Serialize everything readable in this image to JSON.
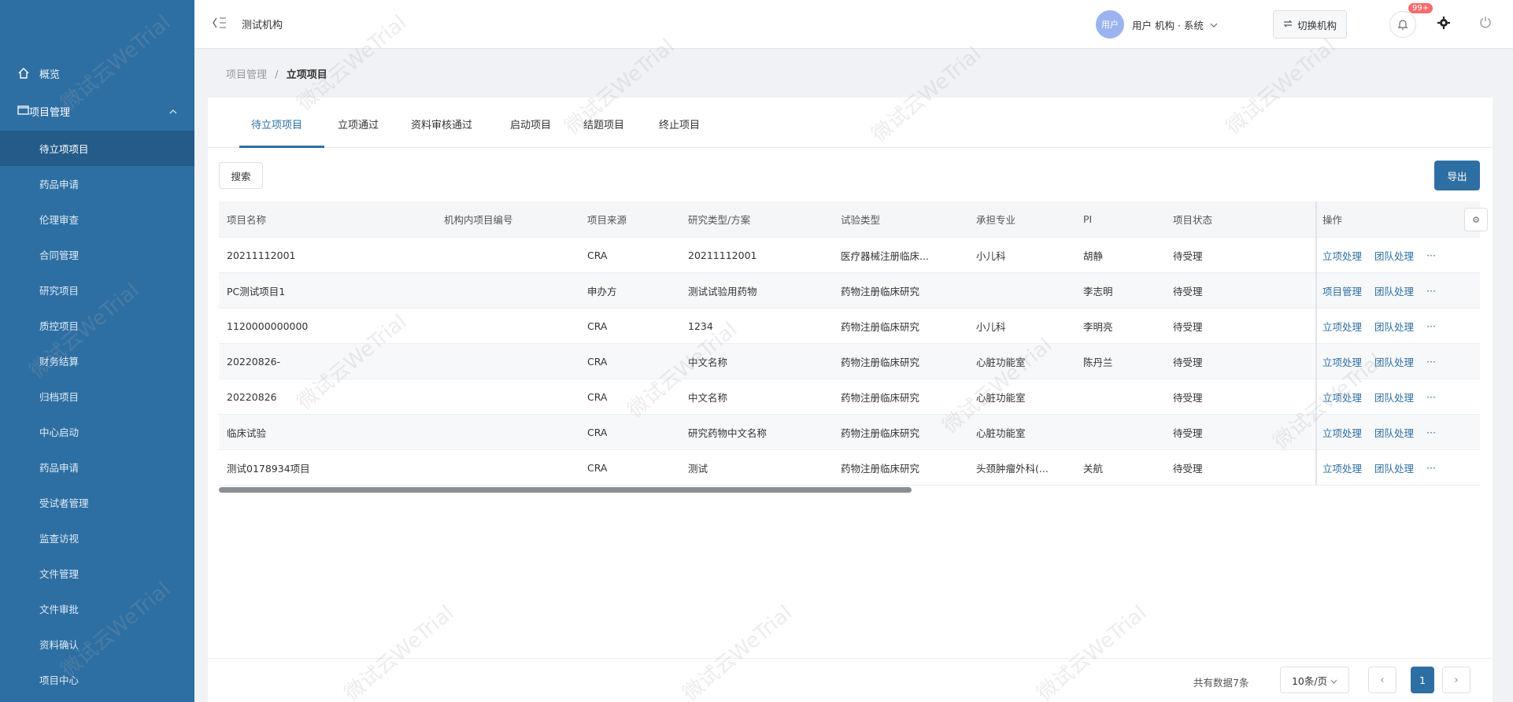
{
  "header": {
    "org_name": "测试机构",
    "avatar_text": "用户",
    "user_text": "用户 机构 · 系统",
    "switch_label": "切换机构",
    "notification_badge": "99+"
  },
  "sidebar": {
    "home_label": "概览",
    "group_label": "项目管理",
    "items": [
      {
        "label": "待立项项目"
      },
      {
        "label": "药品申请"
      },
      {
        "label": "伦理审查"
      },
      {
        "label": "合同管理"
      },
      {
        "label": "研究项目"
      },
      {
        "label": "质控项目"
      },
      {
        "label": "财务结算"
      },
      {
        "label": "归档项目"
      },
      {
        "label": "中心启动"
      },
      {
        "label": "药品申请"
      },
      {
        "label": "受试者管理"
      },
      {
        "label": "监查访视"
      },
      {
        "label": "文件管理"
      },
      {
        "label": "文件审批"
      },
      {
        "label": "资料确认"
      },
      {
        "label": "项目中心"
      }
    ]
  },
  "breadcrumb": {
    "parent": "项目管理",
    "sep": "/",
    "current": "立项项目"
  },
  "tabs": [
    {
      "label": "待立项项目"
    },
    {
      "label": "立项通过"
    },
    {
      "label": "资料审核通过"
    },
    {
      "label": "启动项目"
    },
    {
      "label": "结题项目"
    },
    {
      "label": "终止项目"
    }
  ],
  "toolbar": {
    "search_label": "搜索",
    "export_label": "导出"
  },
  "table": {
    "headers": [
      "项目名称",
      "机构内项目编号",
      "项目来源",
      "研究类型/方案",
      "试验类型",
      "承担专业",
      "PI",
      "项目状态",
      "操作"
    ],
    "column_setting": "⚙",
    "rows": [
      {
        "name": "20211112001",
        "code": "",
        "source": "CRA",
        "plan": "20211112001",
        "type": "医疗器械注册临床...",
        "dept": "小儿科",
        "pi": "胡静",
        "status": "待受理",
        "op1": "立项处理",
        "op2": "团队处理",
        "more": "···"
      },
      {
        "name": "PC测试项目1",
        "code": "",
        "source": "申办方",
        "plan": "测试试验用药物",
        "type": "药物注册临床研究",
        "dept": "",
        "pi": "李志明",
        "status": "待受理",
        "op1": "项目管理",
        "op2": "团队处理",
        "more": "···"
      },
      {
        "name": "1120000000000",
        "code": "",
        "source": "CRA",
        "plan": "1234",
        "type": "药物注册临床研究",
        "dept": "小儿科",
        "pi": "李明亮",
        "status": "待受理",
        "op1": "立项处理",
        "op2": "团队处理",
        "more": "···"
      },
      {
        "name": "20220826-",
        "code": "",
        "source": "CRA",
        "plan": "中文名称",
        "type": "药物注册临床研究",
        "dept": "心脏功能室",
        "pi": "陈丹兰",
        "status": "待受理",
        "op1": "立项处理",
        "op2": "团队处理",
        "more": "···"
      },
      {
        "name": "20220826",
        "code": "",
        "source": "CRA",
        "plan": "中文名称",
        "type": "药物注册临床研究",
        "dept": "心脏功能室",
        "pi": "",
        "status": "待受理",
        "op1": "立项处理",
        "op2": "团队处理",
        "more": "···"
      },
      {
        "name": "临床试验",
        "code": "",
        "source": "CRA",
        "plan": "研究药物中文名称",
        "type": "药物注册临床研究",
        "dept": "心脏功能室",
        "pi": "",
        "status": "待受理",
        "op1": "立项处理",
        "op2": "团队处理",
        "more": "···"
      },
      {
        "name": "测试0178934项目",
        "code": "",
        "source": "CRA",
        "plan": "测试",
        "type": "药物注册临床研究",
        "dept": "头颈肿瘤外科(...",
        "pi": "关航",
        "status": "待受理",
        "op1": "立项处理",
        "op2": "团队处理",
        "more": "···"
      }
    ]
  },
  "pagination": {
    "total_text": "共有数据7条",
    "page_size": "10条/页",
    "current_page": "1",
    "prev": "‹",
    "next": "›"
  },
  "watermark_text": "微试云WeTrial"
}
